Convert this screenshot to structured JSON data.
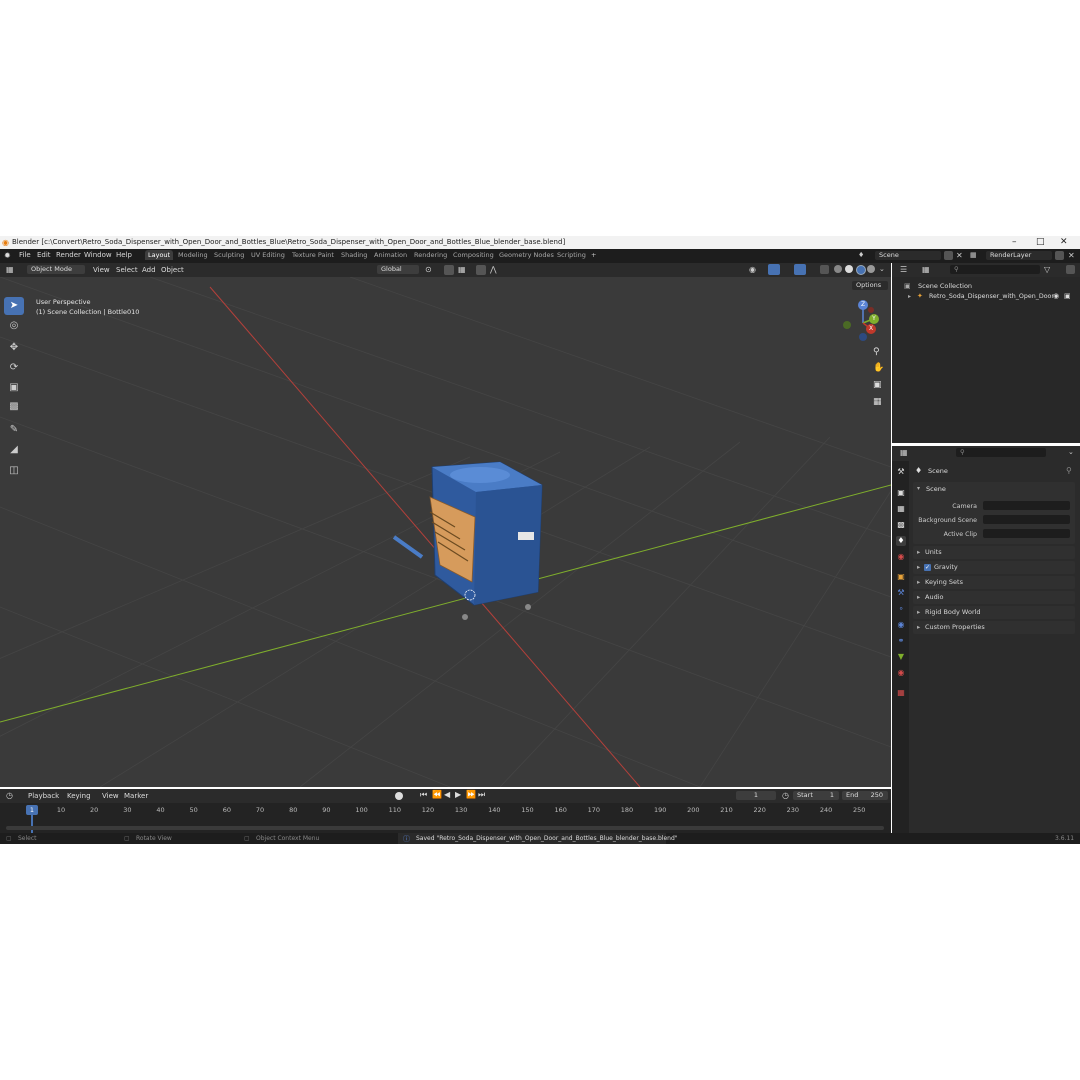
{
  "window": {
    "title": "Blender [c:\\Convert\\Retro_Soda_Dispenser_with_Open_Door_and_Bottles_Blue\\Retro_Soda_Dispenser_with_Open_Door_and_Bottles_Blue_blender_base.blend]"
  },
  "menu": [
    "File",
    "Edit",
    "Render",
    "Window",
    "Help"
  ],
  "workspaces": [
    "Layout",
    "Modeling",
    "Sculpting",
    "UV Editing",
    "Texture Paint",
    "Shading",
    "Animation",
    "Rendering",
    "Compositing",
    "Geometry Nodes",
    "Scripting"
  ],
  "active_workspace": "Layout",
  "scene_field": "Scene",
  "view_layer_field": "RenderLayer",
  "viewport_header": {
    "mode": "Object Mode",
    "menus": [
      "View",
      "Select",
      "Add",
      "Object"
    ],
    "transform_orientation": "Global",
    "options": "Options"
  },
  "viewport": {
    "perspective": "User Perspective",
    "collection_info": "(1) Scene Collection | Bottle010",
    "gizmo": {
      "z": "Z",
      "y": "Y",
      "x": "X"
    }
  },
  "outliner": {
    "root": "Scene Collection",
    "items": [
      "Retro_Soda_Dispenser_with_Open_Door"
    ]
  },
  "properties": {
    "context": "Scene",
    "panel": "Scene",
    "fields": [
      {
        "label": "Camera",
        "value": ""
      },
      {
        "label": "Background Scene",
        "value": ""
      },
      {
        "label": "Active Clip",
        "value": ""
      }
    ],
    "sections": [
      "Units",
      "Gravity",
      "Keying Sets",
      "Audio",
      "Rigid Body World",
      "Custom Properties"
    ]
  },
  "timeline": {
    "menus": [
      "Playback",
      "Keying",
      "View",
      "Marker"
    ],
    "current_frame": "1",
    "start_label": "Start",
    "start": "1",
    "end_label": "End",
    "end": "250",
    "ticks": [
      "1",
      "10",
      "20",
      "30",
      "40",
      "50",
      "60",
      "70",
      "80",
      "90",
      "100",
      "110",
      "120",
      "130",
      "140",
      "150",
      "160",
      "170",
      "180",
      "190",
      "200",
      "210",
      "220",
      "230",
      "240",
      "250"
    ]
  },
  "status_bar": {
    "select": "Select",
    "rotate": "Rotate View",
    "context_menu": "Object Context Menu",
    "message": "Saved \"Retro_Soda_Dispenser_with_Open_Door_and_Bottles_Blue_blender_base.blend\"",
    "version": "3.6.11"
  },
  "colors": {
    "accent": "#4772b3",
    "viewport_bg": "#3a3a3a",
    "x_axis": "#c0392b",
    "y_axis": "#7fae2c",
    "model_blue": "#2f5a9e"
  }
}
